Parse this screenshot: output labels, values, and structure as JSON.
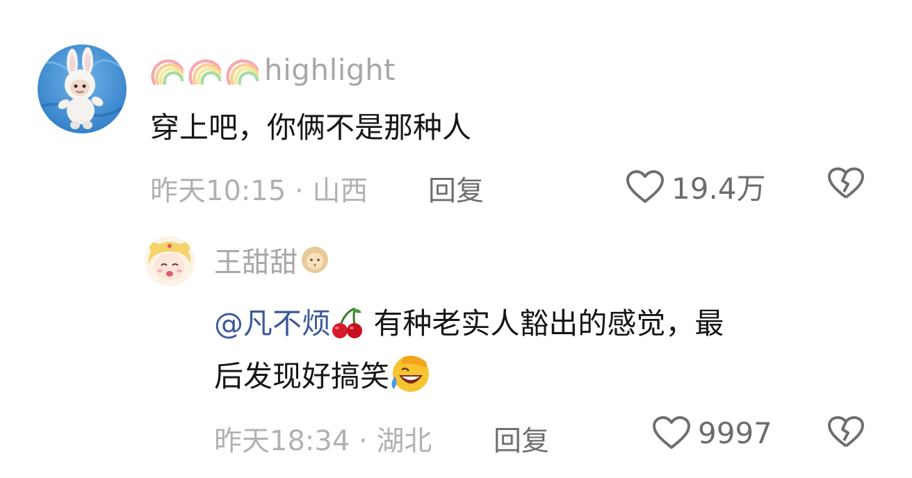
{
  "comment": {
    "user_name": "highlight",
    "name_emojis": [
      "rainbow-icon",
      "rainbow-icon",
      "rainbow-icon"
    ],
    "text": "穿上吧，你俩不是那种人",
    "time": "昨天10:15",
    "separator": " · ",
    "location": "山西",
    "reply_label": "回复",
    "like_count": "19.4万"
  },
  "reply": {
    "user_name": "王甜甜",
    "name_emoji": "lion-icon",
    "mention": "@凡不烦",
    "mention_emoji": "cherries-icon",
    "text_part1": " 有种老实人豁出的感觉，最",
    "text_part2": "后发现好搞笑",
    "text_emoji": "face-palm-laughing-icon",
    "time": "昨天18:34",
    "separator": " · ",
    "location": "湖北",
    "reply_label": "回复",
    "like_count": "9997"
  },
  "colors": {
    "name": "#a7a7a7",
    "text": "#151515",
    "meta": "#b1b1b1",
    "mention": "#3b5998",
    "icon": "#6e6e6e"
  }
}
